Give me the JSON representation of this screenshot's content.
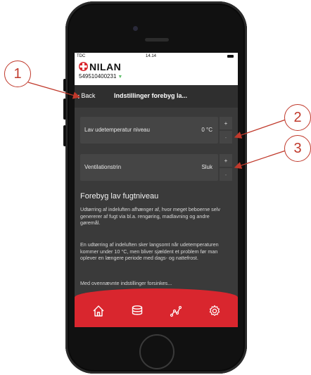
{
  "status_bar": {
    "carrier": "TDC",
    "time": "14.14"
  },
  "brand": {
    "name": "NILAN",
    "serial": "549510400231"
  },
  "nav": {
    "back_label": "Back",
    "title": "Indstillinger forebyg la..."
  },
  "settings": [
    {
      "label": "Lav udetemperatur niveau",
      "value": "0 °C",
      "plus": "+",
      "minus": "-"
    },
    {
      "label": "Ventilationstrin",
      "value": "Sluk",
      "plus": "+",
      "minus": "-"
    }
  ],
  "info": {
    "heading": "Forebyg lav fugtniveau",
    "p1": "Udtørring af indeluften afhænger af, hvor meget beboerne selv genererer af fugt via bl.a. rengøring, madlavning og andre gøremål.",
    "p2": "En udtørring af indeluften sker langsomt når udetemperaturen kommer under 10 °C, men bliver sjældent et problem før man oplever en længere periode med dags- og nattefrost.",
    "p3": "Med ovennævnte indstillinger forsinkes..."
  },
  "tabs": [
    {
      "icon": "home-icon"
    },
    {
      "icon": "layers-icon"
    },
    {
      "icon": "graph-icon"
    },
    {
      "icon": "settings-gear-icon"
    }
  ],
  "callouts": [
    "1",
    "2",
    "3"
  ],
  "colors": {
    "brand_red": "#d9262e",
    "callout_red": "#c0392b",
    "screen_bg": "#3a3a3a"
  }
}
